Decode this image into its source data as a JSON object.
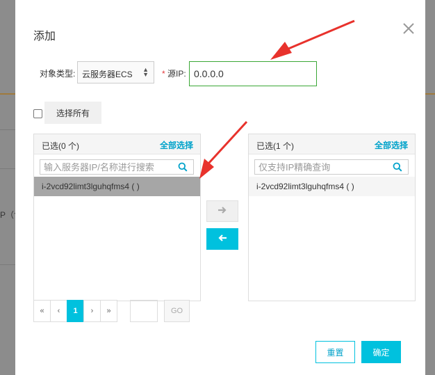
{
  "background": {
    "clipped_text": "P（含"
  },
  "dialog": {
    "title": "添加",
    "close_icon": "close-icon",
    "object_type_label": "对象类型:",
    "object_type_value": "云服务器ECS",
    "required_mark": "*",
    "source_ip_label": "源IP:",
    "source_ip_value": "0.0.0.0",
    "select_all_label": "选择所有"
  },
  "left_panel": {
    "count_label": "已选(0 个)",
    "select_all_link": "全部选择",
    "search_placeholder": "输入服务器IP/名称进行搜索",
    "items": [
      {
        "label": "i-2vcd92limt3lguhqfms4 ( )"
      }
    ]
  },
  "right_panel": {
    "count_label": "已选(1 个)",
    "select_all_link": "全部选择",
    "search_placeholder": "仅支持IP精确查询",
    "items": [
      {
        "label": "i-2vcd92limt3lguhqfms4 ( )"
      }
    ]
  },
  "pagination": {
    "first": "«",
    "prev": "‹",
    "current": "1",
    "next": "›",
    "last": "»",
    "go_label": "GO"
  },
  "footer": {
    "reset_label": "重置",
    "confirm_label": "确定"
  },
  "colors": {
    "accent": "#00c1de",
    "link": "#00a2ca",
    "annotation_arrow": "#e8322c",
    "input_border_focus": "#3aa735"
  }
}
